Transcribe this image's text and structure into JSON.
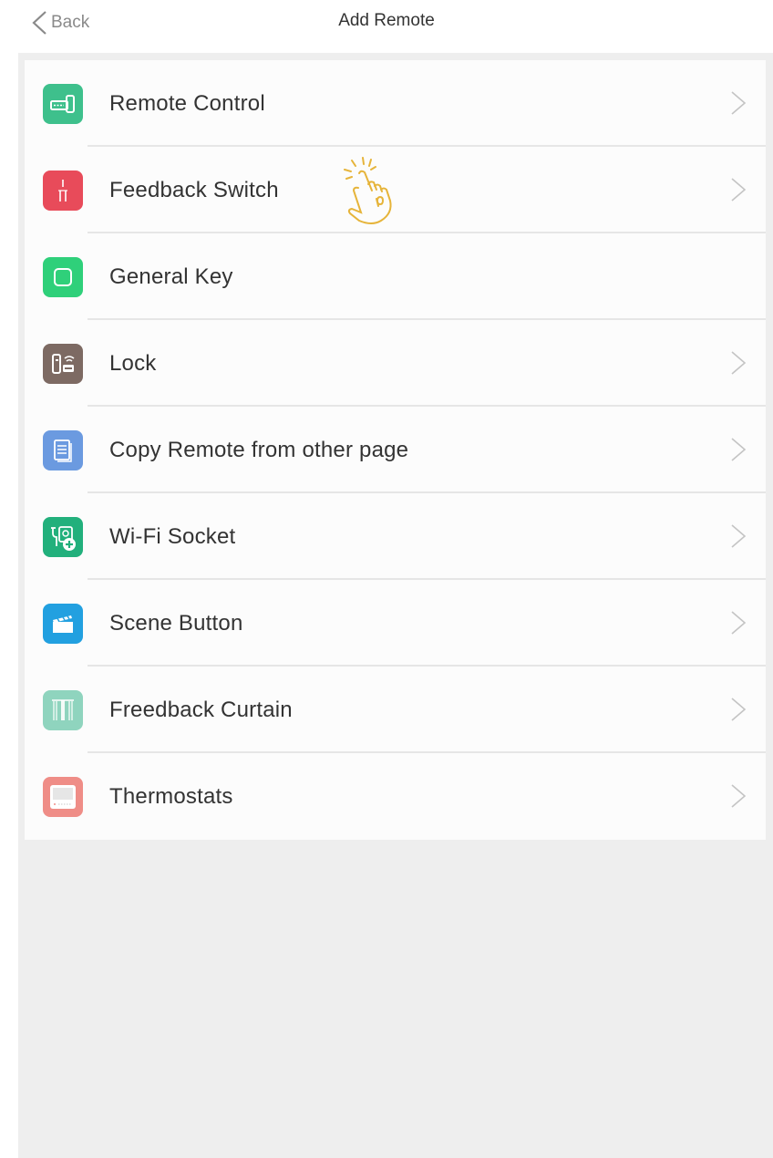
{
  "header": {
    "back_label": "Back",
    "title": "Add Remote"
  },
  "items": [
    {
      "label": "Remote Control",
      "icon": "remote-control-icon",
      "color": "#3ec08c",
      "chevron": true
    },
    {
      "label": "Feedback Switch",
      "icon": "switch-icon",
      "color": "#e84b5a",
      "chevron": true
    },
    {
      "label": "General Key",
      "icon": "key-square-icon",
      "color": "#2fd07a",
      "chevron": false
    },
    {
      "label": "Lock",
      "icon": "lock-icon",
      "color": "#7d6a63",
      "chevron": true
    },
    {
      "label": "Copy Remote from other page",
      "icon": "copy-document-icon",
      "color": "#6b9ae0",
      "chevron": true
    },
    {
      "label": "Wi-Fi Socket",
      "icon": "wifi-socket-icon",
      "color": "#22b07c",
      "chevron": true
    },
    {
      "label": "Scene Button",
      "icon": "clapperboard-icon",
      "color": "#22a0e0",
      "chevron": true
    },
    {
      "label": "Freedback Curtain",
      "icon": "curtain-icon",
      "color": "#8fd4be",
      "chevron": true
    },
    {
      "label": "Thermostats",
      "icon": "thermostat-icon",
      "color": "#ef8d87",
      "chevron": true
    }
  ],
  "colors": {
    "background_panel": "#eeeeee",
    "list_bg": "#fcfcfc",
    "hand_cursor": "#e6b43a"
  }
}
